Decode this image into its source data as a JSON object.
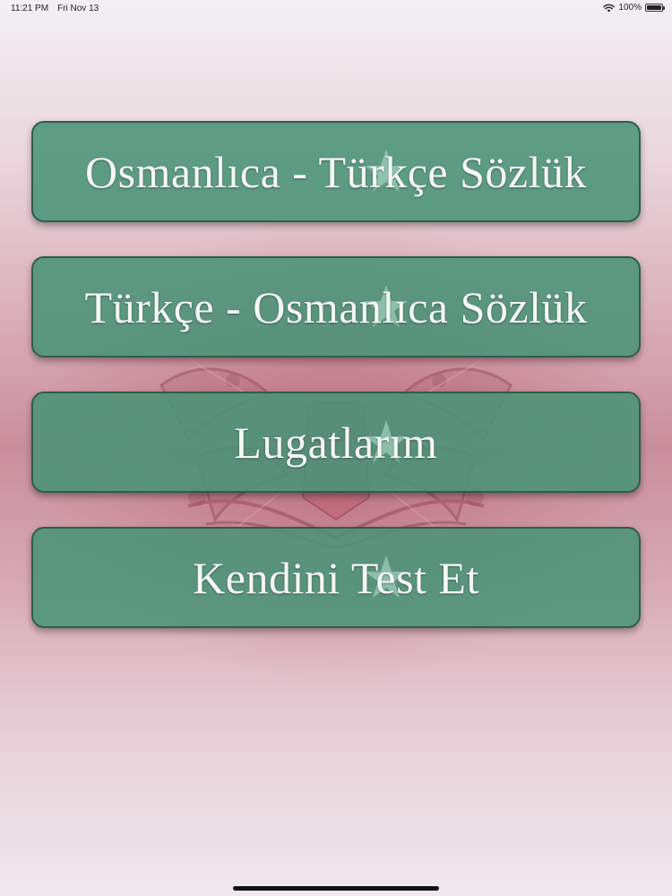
{
  "status_bar": {
    "time": "11:21 PM",
    "date": "Fri Nov 13",
    "battery": "100%",
    "battery_level": 1.0
  },
  "menu": {
    "items": [
      {
        "label": "Osmanlıca - Türkçe Sözlük"
      },
      {
        "label": "Türkçe - Osmanlıca Sözlük"
      },
      {
        "label": "Lugatlarım"
      },
      {
        "label": "Kendini Test Et"
      }
    ]
  },
  "colors": {
    "button_fill": "#4a9378",
    "button_border": "#2f5c4d",
    "button_text": "#f4f7f4",
    "background_tint": "#c98e9d"
  },
  "icons": {
    "background_emblem": "ottoman-coat-of-arms-icon",
    "button_watermark": "crescent-and-star-icon",
    "wifi": "wifi-icon",
    "battery": "battery-icon"
  }
}
